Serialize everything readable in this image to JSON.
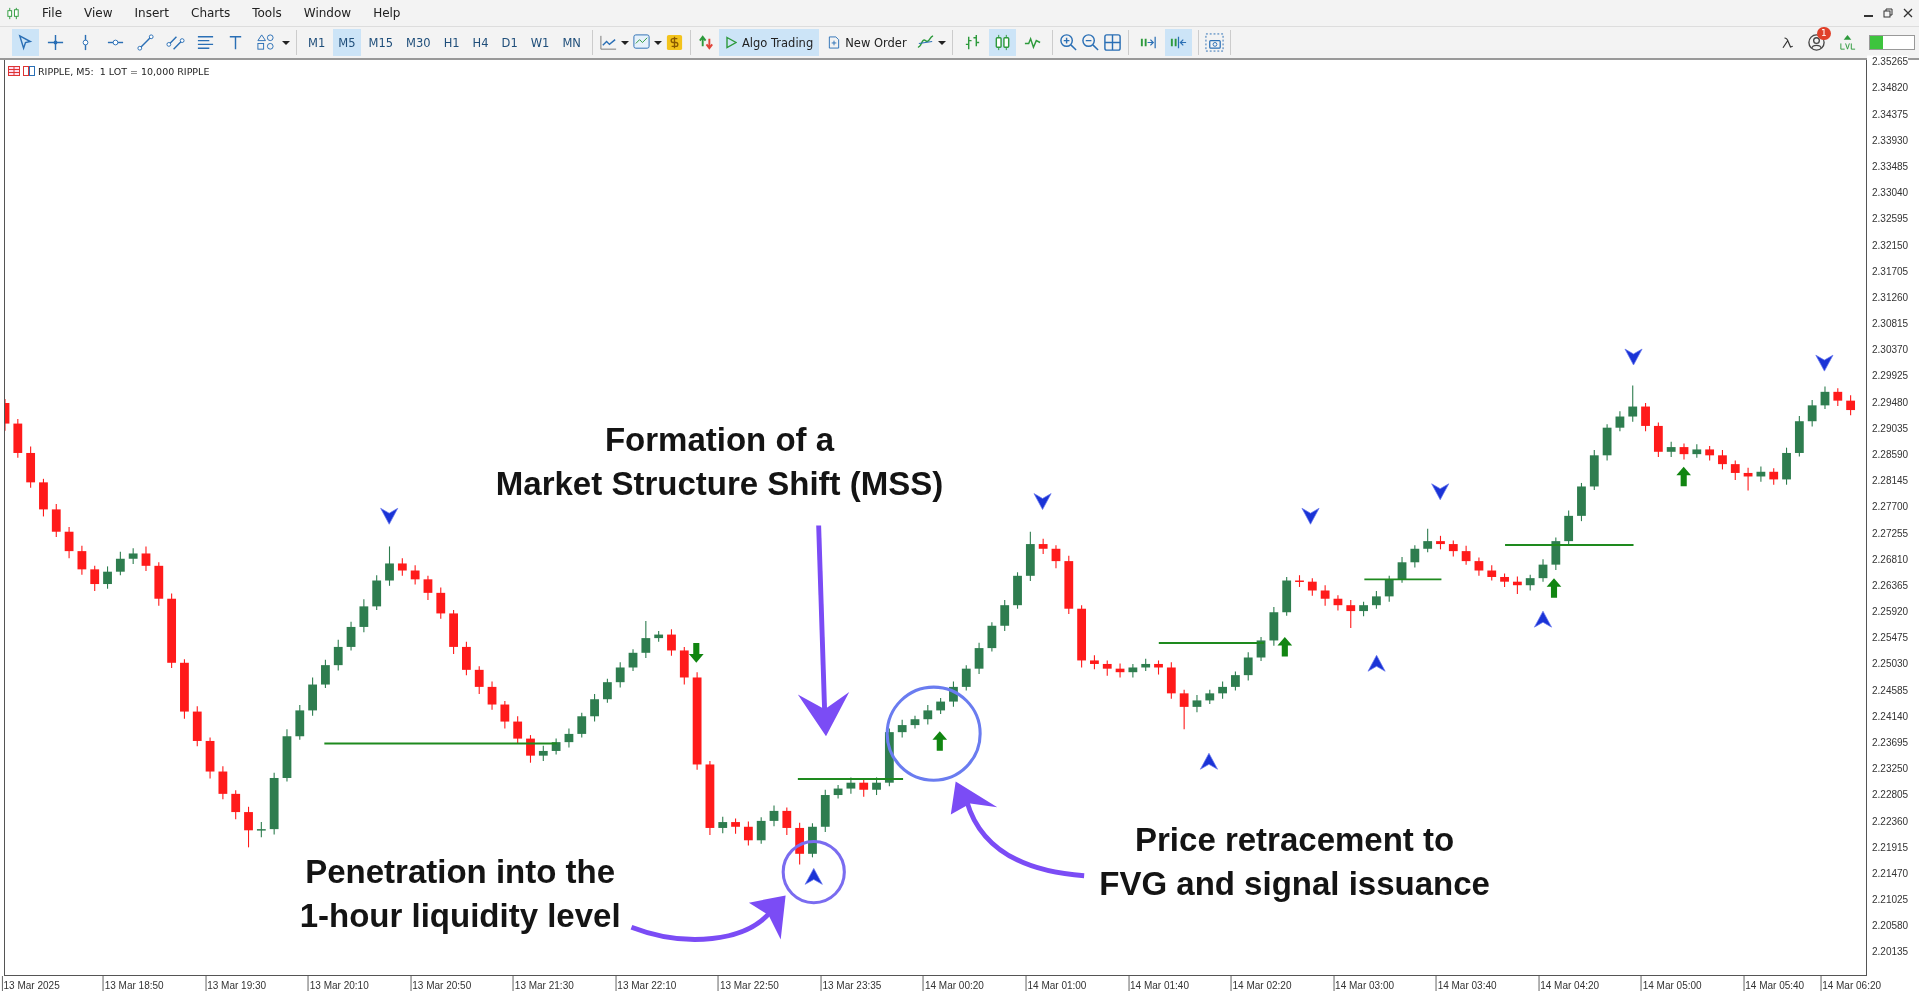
{
  "menu": [
    {
      "label": "File"
    },
    {
      "label": "View"
    },
    {
      "label": "Insert"
    },
    {
      "label": "Charts"
    },
    {
      "label": "Tools"
    },
    {
      "label": "Window"
    },
    {
      "label": "Help"
    }
  ],
  "toolbar": {
    "tools": [
      {
        "kind": "pointer",
        "selected": true
      },
      {
        "kind": "crosshair",
        "selected": false
      },
      {
        "kind": "vline",
        "selected": false
      },
      {
        "kind": "hline",
        "selected": false
      },
      {
        "kind": "trend",
        "selected": false
      },
      {
        "kind": "channel",
        "selected": false
      },
      {
        "kind": "fibo",
        "selected": false
      },
      {
        "kind": "text",
        "selected": false
      },
      {
        "kind": "shapes",
        "selected": false
      }
    ],
    "timeframes": [
      {
        "label": "M1",
        "selected": false
      },
      {
        "label": "M5",
        "selected": true
      },
      {
        "label": "M15",
        "selected": false
      },
      {
        "label": "M30",
        "selected": false
      },
      {
        "label": "H1",
        "selected": false
      },
      {
        "label": "H4",
        "selected": false
      },
      {
        "label": "D1",
        "selected": false
      },
      {
        "label": "W1",
        "selected": false
      },
      {
        "label": "MN",
        "selected": false
      }
    ],
    "algo_trading": {
      "label": "Algo Trading",
      "on": true
    },
    "new_order": {
      "label": "New Order"
    },
    "chart_modes": [
      {
        "kind": "bars",
        "selected": false
      },
      {
        "kind": "candles",
        "selected": true
      },
      {
        "kind": "line",
        "selected": false
      }
    ],
    "view_tools": [
      {
        "kind": "autoscroll",
        "selected": false
      },
      {
        "kind": "shift",
        "selected": true
      }
    ],
    "notification_count": "1"
  },
  "chart": {
    "header": "RIPPLE, M5:  1 LOT = 10,000 RIPPLE",
    "chart_data": {
      "type": "candlestick",
      "ylim": [
        2.19718,
        2.35286
      ],
      "categories": [
        null,
        null,
        "13 Mar 2025",
        null,
        null,
        null,
        null,
        null,
        null,
        null,
        "13 Mar 18:50",
        null,
        null,
        null,
        null,
        null,
        null,
        null,
        "13 Mar 19:30",
        null,
        null,
        null,
        null,
        null,
        null,
        null,
        "13 Mar 20:10",
        null,
        null,
        null,
        null,
        null,
        null,
        null,
        "13 Mar 20:50",
        null,
        null,
        null,
        null,
        null,
        null,
        null,
        "13 Mar 21:30",
        null,
        null,
        null,
        null,
        null,
        null,
        null,
        "13 Mar 22:10",
        null,
        null,
        null,
        null,
        null,
        null,
        null,
        "13 Mar 22:50",
        null,
        null,
        null,
        null,
        null,
        null,
        null,
        "13 Mar 23:35",
        null,
        null,
        null,
        null,
        null,
        null,
        null,
        "14 Mar 00:20",
        null,
        null,
        null,
        null,
        null,
        null,
        null,
        "14 Mar 01:00",
        null,
        null,
        null,
        null,
        null,
        null,
        null,
        "14 Mar 01:40",
        null,
        null,
        null,
        null,
        null,
        null,
        null,
        "14 Mar 02:20",
        null,
        null,
        null,
        null,
        null,
        null,
        null,
        "14 Mar 03:00",
        null,
        null,
        null,
        null,
        null,
        null,
        null,
        "14 Mar 03:40",
        null,
        null,
        null,
        null,
        null,
        null,
        null,
        "14 Mar 04:20",
        null,
        null,
        null,
        null,
        null,
        null,
        null,
        "14 Mar 05:00",
        null,
        null,
        null,
        null,
        null,
        null,
        null,
        "14 Mar 05:40",
        null,
        null,
        null,
        null,
        null,
        "14 Mar 06:20"
      ],
      "yticks": [
        {
          "value": 2.35265,
          "label": "2.35265"
        },
        {
          "value": 2.3482,
          "label": "2.34820"
        },
        {
          "value": 2.34375,
          "label": "2.34375"
        },
        {
          "value": 2.3393,
          "label": "2.33930"
        },
        {
          "value": 2.33485,
          "label": "2.33485"
        },
        {
          "value": 2.3304,
          "label": "2.33040"
        },
        {
          "value": 2.32595,
          "label": "2.32595"
        },
        {
          "value": 2.3215,
          "label": "2.32150"
        },
        {
          "value": 2.31705,
          "label": "2.31705"
        },
        {
          "value": 2.3126,
          "label": "2.31260"
        },
        {
          "value": 2.30815,
          "label": "2.30815"
        },
        {
          "value": 2.3037,
          "label": "2.30370"
        },
        {
          "value": 2.29925,
          "label": "2.29925"
        },
        {
          "value": 2.2948,
          "label": "2.29480"
        },
        {
          "value": 2.29035,
          "label": "2.29035"
        },
        {
          "value": 2.2859,
          "label": "2.28590"
        },
        {
          "value": 2.28145,
          "label": "2.28145"
        },
        {
          "value": 2.277,
          "label": "2.27700"
        },
        {
          "value": 2.27255,
          "label": "2.27255"
        },
        {
          "value": 2.2681,
          "label": "2.26810"
        },
        {
          "value": 2.26365,
          "label": "2.26365"
        },
        {
          "value": 2.2592,
          "label": "2.25920"
        },
        {
          "value": 2.25475,
          "label": "2.25475"
        },
        {
          "value": 2.2503,
          "label": "2.25030"
        },
        {
          "value": 2.24585,
          "label": "2.24585"
        },
        {
          "value": 2.2414,
          "label": "2.24140"
        },
        {
          "value": 2.23695,
          "label": "2.23695"
        },
        {
          "value": 2.2325,
          "label": "2.23250"
        },
        {
          "value": 2.22805,
          "label": "2.22805"
        },
        {
          "value": 2.2236,
          "label": "2.22360"
        },
        {
          "value": 2.21915,
          "label": "2.21915"
        },
        {
          "value": 2.2147,
          "label": "2.21470"
        },
        {
          "value": 2.21025,
          "label": "2.21025"
        },
        {
          "value": 2.2058,
          "label": "2.20580"
        },
        {
          "value": 2.20135,
          "label": "2.20135"
        }
      ],
      "ohlc": [
        [
          2.2945,
          2.2952,
          2.2898,
          2.291
        ],
        [
          2.291,
          2.2918,
          2.2852,
          2.286
        ],
        [
          2.286,
          2.2871,
          2.2801,
          2.281
        ],
        [
          2.281,
          2.2816,
          2.2752,
          2.2764
        ],
        [
          2.2764,
          2.2773,
          2.2717,
          2.2726
        ],
        [
          2.2726,
          2.2734,
          2.2681,
          2.2693
        ],
        [
          2.2693,
          2.2702,
          2.2653,
          2.2662
        ],
        [
          2.2662,
          2.2668,
          2.2625,
          2.2637
        ],
        [
          2.2637,
          2.2667,
          2.2629,
          2.2658
        ],
        [
          2.2658,
          2.2692,
          2.2652,
          2.268
        ],
        [
          2.268,
          2.2698,
          2.2671,
          2.2689
        ],
        [
          2.2689,
          2.2701,
          2.2659,
          2.2668
        ],
        [
          2.2668,
          2.2674,
          2.26,
          2.2612
        ],
        [
          2.2612,
          2.2621,
          2.2494,
          2.2503
        ],
        [
          2.2503,
          2.2509,
          2.2408,
          2.242
        ],
        [
          2.242,
          2.2429,
          2.2361,
          2.237
        ],
        [
          2.237,
          2.2376,
          2.2306,
          2.2318
        ],
        [
          2.2318,
          2.2327,
          2.2271,
          2.228
        ],
        [
          2.228,
          2.2286,
          2.2237,
          2.2249
        ],
        [
          2.2249,
          2.2258,
          2.2189,
          2.2218
        ],
        [
          2.2218,
          2.2232,
          2.2206,
          2.222
        ],
        [
          2.222,
          2.2316,
          2.2211,
          2.2307
        ],
        [
          2.2307,
          2.239,
          2.2301,
          2.2378
        ],
        [
          2.2378,
          2.2431,
          2.2372,
          2.2422
        ],
        [
          2.2422,
          2.2478,
          2.2413,
          2.2466
        ],
        [
          2.2466,
          2.2508,
          2.246,
          2.2499
        ],
        [
          2.2499,
          2.2542,
          2.249,
          2.253
        ],
        [
          2.253,
          2.2573,
          2.2524,
          2.2564
        ],
        [
          2.2564,
          2.2611,
          2.2555,
          2.2599
        ],
        [
          2.2599,
          2.2652,
          2.2593,
          2.2643
        ],
        [
          2.2643,
          2.2701,
          2.2634,
          2.2672
        ],
        [
          2.2672,
          2.2681,
          2.2651,
          2.266
        ],
        [
          2.266,
          2.2669,
          2.2636,
          2.2645
        ],
        [
          2.2645,
          2.2651,
          2.261,
          2.2622
        ],
        [
          2.2622,
          2.2631,
          2.2578,
          2.2587
        ],
        [
          2.2587,
          2.2593,
          2.2518,
          2.253
        ],
        [
          2.253,
          2.2539,
          2.2482,
          2.2491
        ],
        [
          2.2491,
          2.2497,
          2.245,
          2.2462
        ],
        [
          2.2462,
          2.2471,
          2.2423,
          2.2432
        ],
        [
          2.2432,
          2.2438,
          2.2391,
          2.2403
        ],
        [
          2.2403,
          2.2412,
          2.2365,
          2.2374
        ],
        [
          2.2374,
          2.238,
          2.2333,
          2.2345
        ],
        [
          2.2345,
          2.2362,
          2.2336,
          2.2353
        ],
        [
          2.2353,
          2.2374,
          2.2347,
          2.2368
        ],
        [
          2.2368,
          2.2391,
          2.2359,
          2.2382
        ],
        [
          2.2382,
          2.2418,
          2.2376,
          2.2412
        ],
        [
          2.2412,
          2.245,
          2.2403,
          2.2441
        ],
        [
          2.2441,
          2.2476,
          2.2435,
          2.247
        ],
        [
          2.247,
          2.2504,
          2.2461,
          2.2495
        ],
        [
          2.2495,
          2.2526,
          2.2489,
          2.252
        ],
        [
          2.252,
          2.2574,
          2.2511,
          2.2545
        ],
        [
          2.2545,
          2.2557,
          2.2539,
          2.2551
        ],
        [
          2.2551,
          2.256,
          2.2515,
          2.2524
        ],
        [
          2.2524,
          2.253,
          2.2466,
          2.2478
        ],
        [
          2.2478,
          2.2487,
          2.2321,
          2.233
        ],
        [
          2.233,
          2.2336,
          2.221,
          2.2222
        ],
        [
          2.2222,
          2.2241,
          2.2213,
          2.2232
        ],
        [
          2.2232,
          2.2238,
          2.2212,
          2.2224
        ],
        [
          2.2224,
          2.2233,
          2.2192,
          2.2201
        ],
        [
          2.2201,
          2.224,
          2.2195,
          2.2234
        ],
        [
          2.2234,
          2.226,
          2.2225,
          2.2251
        ],
        [
          2.2251,
          2.2257,
          2.221,
          2.2222
        ],
        [
          2.2222,
          2.2231,
          2.216,
          2.2178
        ],
        [
          2.2178,
          2.223,
          2.2172,
          2.2224
        ],
        [
          2.2224,
          2.2287,
          2.2215,
          2.2278
        ],
        [
          2.2278,
          2.2295,
          2.2272,
          2.2289
        ],
        [
          2.2289,
          2.2308,
          2.228,
          2.2299
        ],
        [
          2.2299,
          2.2305,
          2.2275,
          2.2287
        ],
        [
          2.2287,
          2.2308,
          2.2278,
          2.2299
        ],
        [
          2.2299,
          2.2391,
          2.2293,
          2.2385
        ],
        [
          2.2385,
          2.2406,
          2.2376,
          2.2397
        ],
        [
          2.2397,
          2.2413,
          2.2391,
          2.2407
        ],
        [
          2.2407,
          2.2431,
          2.2398,
          2.2422
        ],
        [
          2.2422,
          2.2443,
          2.2416,
          2.2437
        ],
        [
          2.2437,
          2.2471,
          2.2428,
          2.2462
        ],
        [
          2.2462,
          2.2499,
          2.2456,
          2.2493
        ],
        [
          2.2493,
          2.2537,
          2.2484,
          2.2528
        ],
        [
          2.2528,
          2.2572,
          2.2522,
          2.2566
        ],
        [
          2.2566,
          2.261,
          2.2557,
          2.2601
        ],
        [
          2.2601,
          2.2657,
          2.2595,
          2.2651
        ],
        [
          2.2651,
          2.2726,
          2.2642,
          2.2705
        ],
        [
          2.2705,
          2.2714,
          2.2688,
          2.2697
        ],
        [
          2.2697,
          2.2703,
          2.2664,
          2.2676
        ],
        [
          2.2676,
          2.2685,
          2.2586,
          2.2595
        ],
        [
          2.2595,
          2.2601,
          2.2495,
          2.2507
        ],
        [
          2.2507,
          2.2516,
          2.2492,
          2.2501
        ],
        [
          2.2501,
          2.2507,
          2.2481,
          2.2493
        ],
        [
          2.2493,
          2.2502,
          2.2478,
          2.2487
        ],
        [
          2.2487,
          2.2501,
          2.2478,
          2.2495
        ],
        [
          2.2495,
          2.251,
          2.2489,
          2.2501
        ],
        [
          2.2501,
          2.2507,
          2.2483,
          2.2495
        ],
        [
          2.2495,
          2.2504,
          2.2442,
          2.2451
        ],
        [
          2.2451,
          2.2457,
          2.239,
          2.2428
        ],
        [
          2.2428,
          2.2448,
          2.2419,
          2.2439
        ],
        [
          2.2439,
          2.2457,
          2.2433,
          2.2451
        ],
        [
          2.2451,
          2.2471,
          2.2442,
          2.2462
        ],
        [
          2.2462,
          2.2488,
          2.2456,
          2.2482
        ],
        [
          2.2482,
          2.2521,
          2.2473,
          2.2512
        ],
        [
          2.2512,
          2.2547,
          2.2506,
          2.2541
        ],
        [
          2.2541,
          2.2598,
          2.2532,
          2.2589
        ],
        [
          2.2589,
          2.2649,
          2.2583,
          2.2643
        ],
        [
          2.2643,
          2.2652,
          2.2632,
          2.2641
        ],
        [
          2.2641,
          2.2647,
          2.2617,
          2.2626
        ],
        [
          2.2626,
          2.2635,
          2.26,
          2.2612
        ],
        [
          2.2612,
          2.2618,
          2.2592,
          2.2601
        ],
        [
          2.2601,
          2.261,
          2.2562,
          2.2591
        ],
        [
          2.2591,
          2.2607,
          2.2582,
          2.2601
        ],
        [
          2.2601,
          2.2625,
          2.2595,
          2.2616
        ],
        [
          2.2616,
          2.2651,
          2.2607,
          2.2645
        ],
        [
          2.2645,
          2.2683,
          2.2639,
          2.2674
        ],
        [
          2.2674,
          2.2703,
          2.2665,
          2.2697
        ],
        [
          2.2697,
          2.2731,
          2.2691,
          2.271
        ],
        [
          2.271,
          2.2719,
          2.2696,
          2.2705
        ],
        [
          2.2705,
          2.2711,
          2.2684,
          2.2693
        ],
        [
          2.2693,
          2.2702,
          2.267,
          2.2676
        ],
        [
          2.2676,
          2.2682,
          2.2651,
          2.266
        ],
        [
          2.266,
          2.2669,
          2.2643,
          2.2649
        ],
        [
          2.2649,
          2.2655,
          2.2632,
          2.2641
        ],
        [
          2.2641,
          2.265,
          2.262,
          2.2635
        ],
        [
          2.2635,
          2.2653,
          2.2626,
          2.2647
        ],
        [
          2.2647,
          2.2679,
          2.2641,
          2.267
        ],
        [
          2.267,
          2.2716,
          2.2661,
          2.271
        ],
        [
          2.271,
          2.2762,
          2.2704,
          2.2753
        ],
        [
          2.2753,
          2.2809,
          2.2744,
          2.2803
        ],
        [
          2.2803,
          2.2865,
          2.2797,
          2.2856
        ],
        [
          2.2856,
          2.2909,
          2.2847,
          2.2903
        ],
        [
          2.2903,
          2.2931,
          2.2897,
          2.2922
        ],
        [
          2.2922,
          2.2975,
          2.2913,
          2.2939
        ],
        [
          2.2939,
          2.2945,
          2.2897,
          2.2906
        ],
        [
          2.2906,
          2.2912,
          2.2853,
          2.2862
        ],
        [
          2.2862,
          2.2879,
          2.2853,
          2.287
        ],
        [
          2.287,
          2.2876,
          2.2849,
          2.2858
        ],
        [
          2.2858,
          2.2875,
          2.2852,
          2.2866
        ],
        [
          2.2866,
          2.2872,
          2.2847,
          2.2856
        ],
        [
          2.2856,
          2.2865,
          2.2832,
          2.2841
        ],
        [
          2.2841,
          2.2847,
          2.2814,
          2.2826
        ],
        [
          2.2826,
          2.2835,
          2.2796,
          2.282
        ],
        [
          2.282,
          2.2837,
          2.2811,
          2.2828
        ],
        [
          2.2828,
          2.2834,
          2.2806,
          2.2815
        ],
        [
          2.2815,
          2.2869,
          2.2806,
          2.286
        ],
        [
          2.286,
          2.2923,
          2.2854,
          2.2914
        ],
        [
          2.2914,
          2.295,
          2.2905,
          2.2941
        ],
        [
          2.2941,
          2.2973,
          2.2935,
          2.2964
        ],
        [
          2.2964,
          2.297,
          2.294,
          2.2949
        ],
        [
          2.2949,
          2.2958,
          2.2924,
          2.2933
        ]
      ]
    },
    "annotations": [
      {
        "lines": [
          "Formation of a",
          "Market Structure Shift (MSS)"
        ]
      },
      {
        "lines": [
          "Penetration into the",
          "1-hour liquidity level"
        ]
      },
      {
        "lines": [
          "Price retracement to",
          "FVG and signal issuance"
        ]
      }
    ]
  }
}
